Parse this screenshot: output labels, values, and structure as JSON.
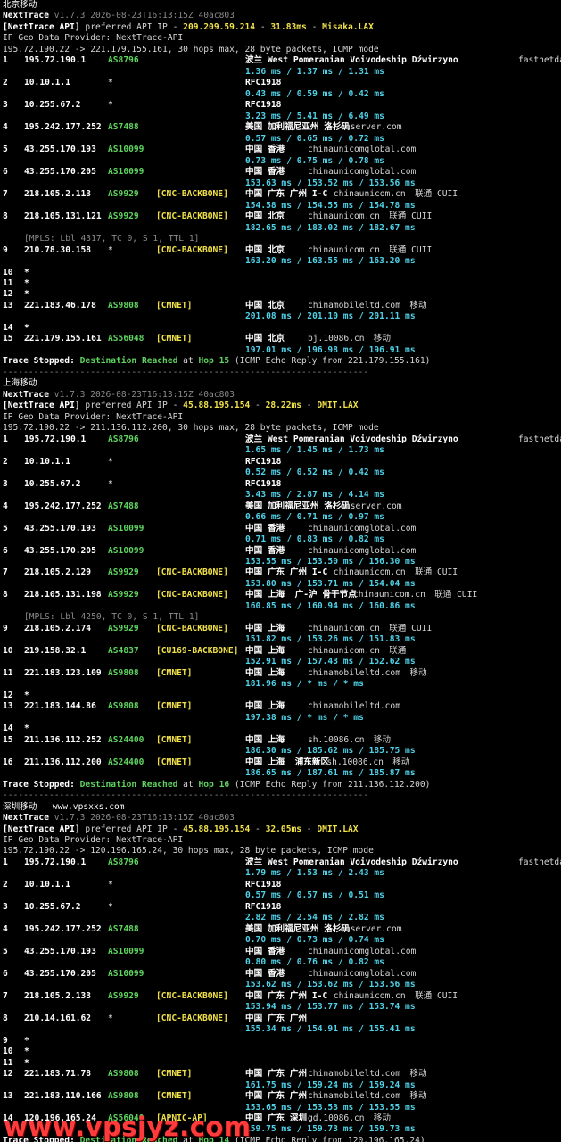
{
  "sections": [
    {
      "title": "北京移动",
      "title_extra": "",
      "header": {
        "name": "NextTrace",
        "version": "v1.7.3 2026-08-23T16:13:15Z 40ac803"
      },
      "api": {
        "prefix": "[NextTrace API]",
        "mid": " preferred API IP - ",
        "ip": "209.209.59.214",
        "sep1": " - ",
        "latency": "31.83ms",
        "sep2": " - ",
        "node": "Misaka.LAX"
      },
      "geo_provider": "IP Geo Data Provider: NextTrace-API",
      "command": "195.72.190.22 -> 221.179.155.161, 30 hops max, 28 byte packets, ICMP mode",
      "hops": [
        {
          "n": "1",
          "ip": "195.72.190.1",
          "asn": "AS8796",
          "tag": "",
          "geo": "波兰 West Pomeranian Voivodeship Dźwirzyno",
          "host": "fastnetdata.com",
          "isp": "",
          "rtt": "1.36 ms / 1.37 ms / 1.31 ms"
        },
        {
          "n": "2",
          "ip": "10.10.1.1",
          "asn": "*",
          "tag": "",
          "geo": "RFC1918",
          "host": "",
          "isp": "",
          "rtt": "0.43 ms / 0.59 ms / 0.42 ms"
        },
        {
          "n": "3",
          "ip": "10.255.67.2",
          "asn": "*",
          "tag": "",
          "geo": "RFC1918",
          "host": "",
          "isp": "",
          "rtt": "3.23 ms / 5.41 ms / 6.49 ms"
        },
        {
          "n": "4",
          "ip": "195.242.177.252",
          "asn": "AS7488",
          "tag": "",
          "geo": "美国 加利福尼亚州 洛杉矶",
          "host": "cnserver.com",
          "isp": "",
          "rtt": "0.57 ms / 0.65 ms / 0.72 ms"
        },
        {
          "n": "5",
          "ip": "43.255.170.193",
          "asn": "AS10099",
          "tag": "",
          "geo": "中国 香港",
          "host": "chinaunicomglobal.com",
          "isp": "",
          "rtt": "0.73 ms / 0.75 ms / 0.78 ms"
        },
        {
          "n": "6",
          "ip": "43.255.170.205",
          "asn": "AS10099",
          "tag": "",
          "geo": "中国 香港",
          "host": "chinaunicomglobal.com",
          "isp": "",
          "rtt": "153.63 ms / 153.52 ms / 153.56 ms"
        },
        {
          "n": "7",
          "ip": "218.105.2.113",
          "asn": "AS9929",
          "tag": "[CNC-BACKBONE]",
          "geo": "中国 广东 广州 I-C",
          "host": "chinaunicom.cn",
          "isp": "联通 CUII",
          "rtt": "154.58 ms / 154.55 ms / 154.78 ms"
        },
        {
          "n": "8",
          "ip": "218.105.131.121",
          "asn": "AS9929",
          "tag": "[CNC-BACKBONE]",
          "geo": "中国 北京",
          "host": "chinaunicom.cn",
          "isp": "联通 CUII",
          "rtt": "182.65 ms / 183.02 ms / 182.67 ms"
        },
        {
          "mpls": "[MPLS: Lbl 4317, TC 0, S 1, TTL 1]"
        },
        {
          "n": "9",
          "ip": "210.78.30.158",
          "asn": "*",
          "tag": "[CNC-BACKBONE]",
          "geo": "中国 北京",
          "host": "chinaunicom.cn",
          "isp": "联通 CUII",
          "rtt": "163.20 ms / 163.55 ms / 163.20 ms"
        },
        {
          "n": "10",
          "star": "*"
        },
        {
          "n": "11",
          "star": "*"
        },
        {
          "n": "12",
          "star": "*"
        },
        {
          "n": "13",
          "ip": "221.183.46.178",
          "asn": "AS9808",
          "tag": "[CMNET]",
          "geo": "中国 北京",
          "host": "chinamobileltd.com",
          "isp": "移动",
          "rtt": "201.08 ms / 201.10 ms / 201.11 ms"
        },
        {
          "n": "14",
          "star": "*"
        },
        {
          "n": "15",
          "ip": "221.179.155.161",
          "asn": "AS56048",
          "tag": "[CMNET]",
          "geo": "中国 北京",
          "host": "bj.10086.cn",
          "isp": "移动",
          "rtt": "197.01 ms / 196.98 ms / 196.91 ms"
        }
      ],
      "stop": {
        "a": "Trace Stopped: ",
        "b": "Destination Reached",
        "c": " at ",
        "d": "Hop 15",
        "e": " (ICMP Echo Reply from 221.179.155.161)"
      }
    },
    {
      "title": "上海移动",
      "title_extra": "",
      "header": {
        "name": "NextTrace",
        "version": "v1.7.3 2026-08-23T16:13:15Z 40ac803"
      },
      "api": {
        "prefix": "[NextTrace API]",
        "mid": " preferred API IP - ",
        "ip": "45.88.195.154",
        "sep1": " - ",
        "latency": "28.22ms",
        "sep2": " - ",
        "node": "DMIT.LAX"
      },
      "geo_provider": "IP Geo Data Provider: NextTrace-API",
      "command": "195.72.190.22 -> 211.136.112.200, 30 hops max, 28 byte packets, ICMP mode",
      "hops": [
        {
          "n": "1",
          "ip": "195.72.190.1",
          "asn": "AS8796",
          "tag": "",
          "geo": "波兰 West Pomeranian Voivodeship Dźwirzyno",
          "host": "fastnetdata.com",
          "isp": "",
          "rtt": "1.65 ms / 1.45 ms / 1.73 ms"
        },
        {
          "n": "2",
          "ip": "10.10.1.1",
          "asn": "*",
          "tag": "",
          "geo": "RFC1918",
          "host": "",
          "isp": "",
          "rtt": "0.52 ms / 0.52 ms / 0.42 ms"
        },
        {
          "n": "3",
          "ip": "10.255.67.2",
          "asn": "*",
          "tag": "",
          "geo": "RFC1918",
          "host": "",
          "isp": "",
          "rtt": "3.43 ms / 2.87 ms / 4.14 ms"
        },
        {
          "n": "4",
          "ip": "195.242.177.252",
          "asn": "AS7488",
          "tag": "",
          "geo": "美国 加利福尼亚州 洛杉矶",
          "host": "cnserver.com",
          "isp": "",
          "rtt": "0.66 ms / 0.71 ms / 0.97 ms"
        },
        {
          "n": "5",
          "ip": "43.255.170.193",
          "asn": "AS10099",
          "tag": "",
          "geo": "中国 香港",
          "host": "chinaunicomglobal.com",
          "isp": "",
          "rtt": "0.71 ms / 0.83 ms / 0.82 ms"
        },
        {
          "n": "6",
          "ip": "43.255.170.205",
          "asn": "AS10099",
          "tag": "",
          "geo": "中国 香港",
          "host": "chinaunicomglobal.com",
          "isp": "",
          "rtt": "153.55 ms / 153.50 ms / 156.30 ms"
        },
        {
          "n": "7",
          "ip": "218.105.2.129",
          "asn": "AS9929",
          "tag": "[CNC-BACKBONE]",
          "geo": "中国 广东 广州 I-C",
          "host": "chinaunicom.cn",
          "isp": "联通 CUII",
          "rtt": "153.80 ms / 153.71 ms / 154.04 ms"
        },
        {
          "n": "8",
          "ip": "218.105.131.198",
          "asn": "AS9929",
          "tag": "[CNC-BACKBONE]",
          "geo": "中国 上海  广-沪 骨干节点",
          "host": "chinaunicom.cn",
          "isp": "联通 CUII",
          "rtt": "160.85 ms / 160.94 ms / 160.86 ms"
        },
        {
          "mpls": "[MPLS: Lbl 4250, TC 0, S 1, TTL 1]"
        },
        {
          "n": "9",
          "ip": "218.105.2.174",
          "asn": "AS9929",
          "tag": "[CNC-BACKBONE]",
          "geo": "中国 上海",
          "host": "chinaunicom.cn",
          "isp": "联通 CUII",
          "rtt": "151.82 ms / 153.26 ms / 151.83 ms"
        },
        {
          "n": "10",
          "ip": "219.158.32.1",
          "asn": "AS4837",
          "tag": "[CU169-BACKBONE]",
          "geo": "中国 上海",
          "host": "chinaunicom.cn",
          "isp": "联通",
          "rtt": "152.91 ms / 157.43 ms / 152.62 ms"
        },
        {
          "n": "11",
          "ip": "221.183.123.109",
          "asn": "AS9808",
          "tag": "[CMNET]",
          "geo": "中国 上海",
          "host": "chinamobileltd.com",
          "isp": "移动",
          "rtt": "181.96 ms / * ms / * ms"
        },
        {
          "n": "12",
          "star": "*"
        },
        {
          "n": "13",
          "ip": "221.183.144.86",
          "asn": "AS9808",
          "tag": "[CMNET]",
          "geo": "中国 上海",
          "host": "chinamobileltd.com",
          "isp": "",
          "rtt": "197.38 ms / * ms / * ms"
        },
        {
          "n": "14",
          "star": "*"
        },
        {
          "n": "15",
          "ip": "211.136.112.252",
          "asn": "AS24400",
          "tag": "[CMNET]",
          "geo": "中国 上海",
          "host": "sh.10086.cn",
          "isp": "移动",
          "rtt": "186.30 ms / 185.62 ms / 185.75 ms"
        },
        {
          "n": "16",
          "ip": "211.136.112.200",
          "asn": "AS24400",
          "tag": "[CMNET]",
          "geo": "中国 上海  浦东新区",
          "host": "sh.10086.cn",
          "isp": "移动",
          "rtt": "186.65 ms / 187.61 ms / 185.87 ms"
        }
      ],
      "stop": {
        "a": "Trace Stopped: ",
        "b": "Destination Reached",
        "c": " at ",
        "d": "Hop 16",
        "e": " (ICMP Echo Reply from 211.136.112.200)"
      }
    },
    {
      "title": "深圳移动",
      "title_extra": "www.vpsxxs.com",
      "header": {
        "name": "NextTrace",
        "version": "v1.7.3 2026-08-23T16:13:15Z 40ac803"
      },
      "api": {
        "prefix": "[NextTrace API]",
        "mid": " preferred API IP - ",
        "ip": "45.88.195.154",
        "sep1": " - ",
        "latency": "32.05ms",
        "sep2": " - ",
        "node": "DMIT.LAX"
      },
      "geo_provider": "IP Geo Data Provider: NextTrace-API",
      "command": "195.72.190.22 -> 120.196.165.24, 30 hops max, 28 byte packets, ICMP mode",
      "hops": [
        {
          "n": "1",
          "ip": "195.72.190.1",
          "asn": "AS8796",
          "tag": "",
          "geo": "波兰 West Pomeranian Voivodeship Dźwirzyno",
          "host": "fastnetdata.com",
          "isp": "",
          "rtt": "1.79 ms / 1.53 ms / 2.43 ms"
        },
        {
          "n": "2",
          "ip": "10.10.1.1",
          "asn": "*",
          "tag": "",
          "geo": "RFC1918",
          "host": "",
          "isp": "",
          "rtt": "0.57 ms / 0.57 ms / 0.51 ms"
        },
        {
          "n": "3",
          "ip": "10.255.67.2",
          "asn": "*",
          "tag": "",
          "geo": "RFC1918",
          "host": "",
          "isp": "",
          "rtt": "2.82 ms / 2.54 ms / 2.82 ms"
        },
        {
          "n": "4",
          "ip": "195.242.177.252",
          "asn": "AS7488",
          "tag": "",
          "geo": "美国 加利福尼亚州 洛杉矶",
          "host": "cnserver.com",
          "isp": "",
          "rtt": "0.70 ms / 0.73 ms / 0.74 ms"
        },
        {
          "n": "5",
          "ip": "43.255.170.193",
          "asn": "AS10099",
          "tag": "",
          "geo": "中国 香港",
          "host": "chinaunicomglobal.com",
          "isp": "",
          "rtt": "0.80 ms / 0.76 ms / 0.82 ms"
        },
        {
          "n": "6",
          "ip": "43.255.170.205",
          "asn": "AS10099",
          "tag": "",
          "geo": "中国 香港",
          "host": "chinaunicomglobal.com",
          "isp": "",
          "rtt": "153.62 ms / 153.62 ms / 153.56 ms"
        },
        {
          "n": "7",
          "ip": "218.105.2.133",
          "asn": "AS9929",
          "tag": "[CNC-BACKBONE]",
          "geo": "中国 广东 广州 I-C",
          "host": "chinaunicom.cn",
          "isp": "联通 CUII",
          "rtt": "153.94 ms / 153.77 ms / 153.74 ms"
        },
        {
          "n": "8",
          "ip": "210.14.161.62",
          "asn": "*",
          "tag": "[CNC-BACKBONE]",
          "geo": "中国 广东 广州",
          "host": "",
          "isp": "",
          "rtt": "155.34 ms / 154.91 ms / 155.41 ms"
        },
        {
          "n": "9",
          "star": "*"
        },
        {
          "n": "10",
          "star": "*"
        },
        {
          "n": "11",
          "star": "*"
        },
        {
          "n": "12",
          "ip": "221.183.71.78",
          "asn": "AS9808",
          "tag": "[CMNET]",
          "geo": "中国 广东 广州",
          "host": "chinamobileltd.com",
          "isp": "移动",
          "rtt": "161.75 ms / 159.24 ms / 159.24 ms"
        },
        {
          "n": "13",
          "ip": "221.183.110.166",
          "asn": "AS9808",
          "tag": "[CMNET]",
          "geo": "中国 广东 广州",
          "host": "chinamobileltd.com",
          "isp": "移动",
          "rtt": "153.65 ms / 153.53 ms / 153.55 ms"
        },
        {
          "n": "14",
          "ip": "120.196.165.24",
          "asn": "AS56040",
          "tag": "[APNIC-AP]",
          "geo": "中国 广东 深圳",
          "host": "gd.10086.cn",
          "isp": "移动",
          "rtt": "159.75 ms / 159.73 ms / 159.73 ms"
        }
      ],
      "stop": {
        "a": "Trace Stopped: ",
        "b": "Destination Reached",
        "c": " at ",
        "d": "Hop 14",
        "e": " (ICMP Echo Reply from 120.196.165.24)"
      }
    }
  ],
  "separator": "-----------------------------------------------------------------------",
  "watermark": "www.vpsjyz.com",
  "colors": {
    "background": "#000000",
    "text": "#d6d6d6",
    "asn": "#5fd35f",
    "tag": "#f0e14a",
    "rtt": "#4fd2e8",
    "highlight": "#f0e14a",
    "watermark": "#ff3b3b"
  }
}
